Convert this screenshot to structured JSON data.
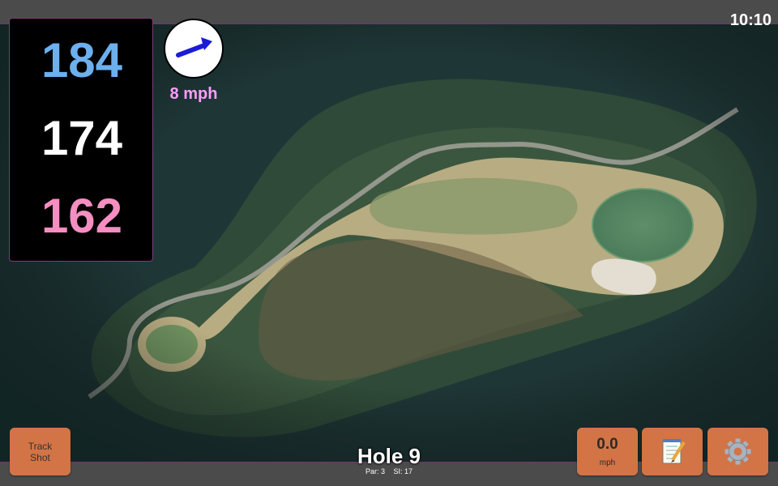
{
  "status": {
    "time": "10:10"
  },
  "distances": {
    "back": "184",
    "center": "174",
    "front": "162",
    "colors": {
      "back": "#6cb0ee",
      "center": "#ffffff",
      "front": "#f58ec1"
    }
  },
  "wind": {
    "speed": "8 mph",
    "direction_icon": "arrow-icon",
    "arrow_color": "#1b1bd8"
  },
  "buttons": {
    "track_shot_line1": "Track",
    "track_shot_line2": "Shot",
    "speed_value": "0.0",
    "speed_unit": "mph",
    "notes_icon": "notepad-icon",
    "settings_icon": "gear-icon",
    "accent": "#d27446"
  },
  "hole": {
    "title": "Hole 9",
    "par": "Par: 3",
    "stroke_index": "SI: 17"
  }
}
